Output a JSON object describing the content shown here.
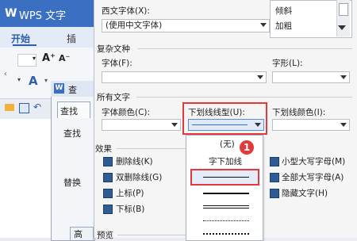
{
  "app": {
    "title": "WPS 文字",
    "logo": "W"
  },
  "ribbon": {
    "tabs": [
      "开始",
      "插入"
    ],
    "tabs_visible": [
      "开始",
      "插"
    ],
    "collapse_glyph": "‹",
    "grow_font": "A⁺",
    "shrink_font": "A⁻",
    "font_style_glyph": "A",
    "more_glyph": "▾",
    "undo_glyph": "↶"
  },
  "find_dialog": {
    "logo": "W",
    "title": "查",
    "tab": "查找",
    "find_label": "查找",
    "replace_label": "替换",
    "advanced_button": "高"
  },
  "font_dialog": {
    "western_font": {
      "label": "西文字体(X):",
      "value": "(使用中文字体)"
    },
    "style_list": {
      "items": [
        "倾斜",
        "加粗"
      ]
    },
    "complex": {
      "section": "复杂文种",
      "font_label": "字体(F):",
      "style_label": "字形(L):"
    },
    "all_text": {
      "section": "所有文字",
      "font_color_label": "字体颜色(C):",
      "underline_type_label": "下划线线型(U):",
      "underline_color_label": "下划线颜色(I):"
    },
    "effects": {
      "section": "效果",
      "strikethrough": "删除线(K)",
      "double_strikethrough": "双删除线(G)",
      "superscript": "上标(P)",
      "subscript": "下标(B)",
      "small_caps": "小型大写字母(M)",
      "all_caps": "全部大写字母(A)",
      "hidden": "隐藏文字(H)"
    },
    "preview": {
      "section": "预览"
    }
  },
  "underline_dropdown": {
    "options": [
      "(无)",
      "字下加线"
    ],
    "selected": "single-line",
    "callout_number": "1"
  },
  "colors": {
    "accent": "#3a6fc2",
    "highlight": "#e23a3a",
    "checkbox": "#2f5d93"
  }
}
